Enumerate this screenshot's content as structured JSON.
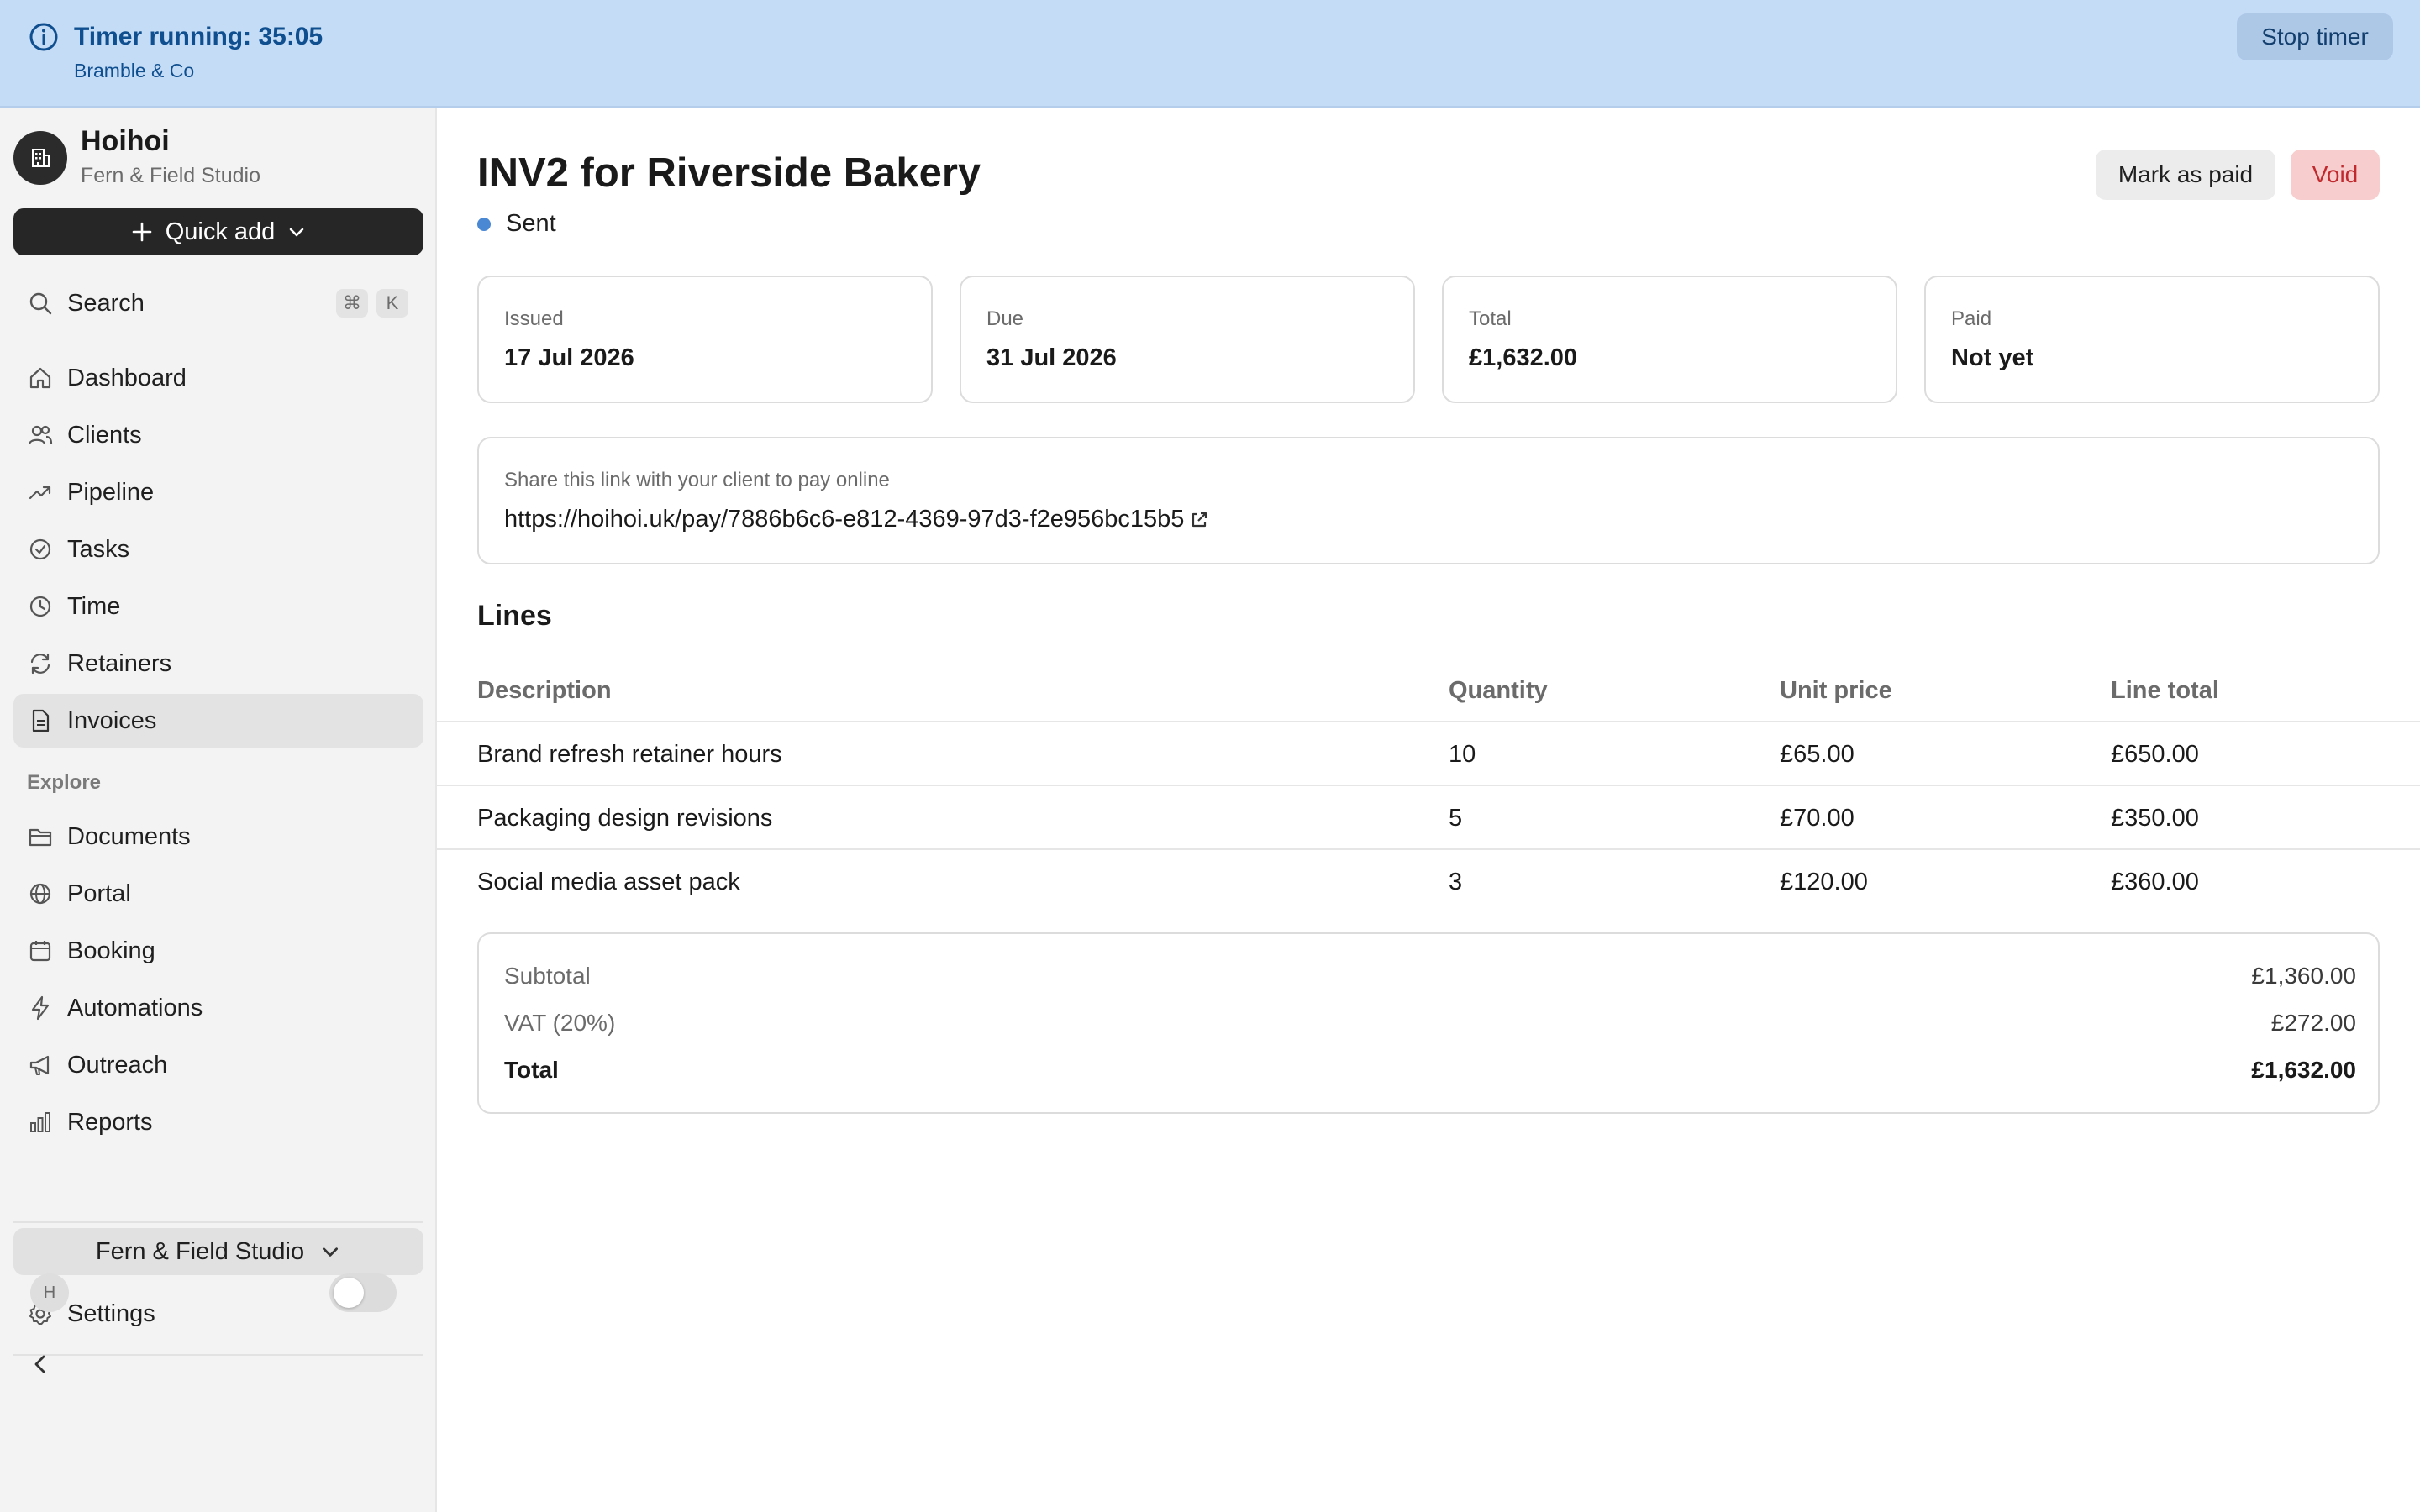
{
  "banner": {
    "timer_text": "Timer running: 35:05",
    "client": "Bramble & Co",
    "stop_label": "Stop timer",
    "background": "#c5dcf6"
  },
  "sidebar": {
    "app_name": "Hoihoi",
    "workspace_sub": "Fern & Field Studio",
    "quick_add_label": "Quick add",
    "search": {
      "label": "Search",
      "kbd_meta": "⌘",
      "kbd_key": "K"
    },
    "items": [
      {
        "label": "Dashboard",
        "icon": "home-icon"
      },
      {
        "label": "Clients",
        "icon": "users-icon"
      },
      {
        "label": "Pipeline",
        "icon": "trending-up-icon"
      },
      {
        "label": "Tasks",
        "icon": "check-circle-icon"
      },
      {
        "label": "Time",
        "icon": "clock-icon"
      },
      {
        "label": "Retainers",
        "icon": "refresh-icon"
      },
      {
        "label": "Invoices",
        "icon": "file-text-icon",
        "active": true
      }
    ],
    "explore_label": "Explore",
    "explore_items": [
      {
        "label": "Documents",
        "icon": "folder-icon"
      },
      {
        "label": "Portal",
        "icon": "globe-icon"
      },
      {
        "label": "Booking",
        "icon": "calendar-icon"
      },
      {
        "label": "Automations",
        "icon": "zap-icon"
      },
      {
        "label": "Outreach",
        "icon": "megaphone-icon"
      },
      {
        "label": "Reports",
        "icon": "bar-chart-icon"
      }
    ],
    "workspace_switcher": "Fern & Field Studio",
    "settings_label": "Settings",
    "avatar_initial": "H"
  },
  "invoice": {
    "title": "INV2 for Riverside Bakery",
    "status": "Sent",
    "status_color": "#4a88d4",
    "mark_paid_label": "Mark as paid",
    "void_label": "Void",
    "cards": [
      {
        "label": "Issued",
        "value": "17 Jul 2026"
      },
      {
        "label": "Due",
        "value": "31 Jul 2026"
      },
      {
        "label": "Total",
        "value": "£1,632.00"
      },
      {
        "label": "Paid",
        "value": "Not yet"
      }
    ],
    "share": {
      "label": "Share this link with your client to pay online",
      "url": "https://hoihoi.uk/pay/7886b6c6-e812-4369-97d3-f2e956bc15b5"
    },
    "lines_heading": "Lines",
    "columns": [
      "Description",
      "Quantity",
      "Unit price",
      "Line total"
    ],
    "lines": [
      {
        "description": "Brand refresh retainer hours",
        "quantity": "10",
        "unit_price": "£65.00",
        "line_total": "£650.00"
      },
      {
        "description": "Packaging design revisions",
        "quantity": "5",
        "unit_price": "£70.00",
        "line_total": "£350.00"
      },
      {
        "description": "Social media asset pack",
        "quantity": "3",
        "unit_price": "£120.00",
        "line_total": "£360.00"
      }
    ],
    "totals": {
      "subtotal_label": "Subtotal",
      "subtotal": "£1,360.00",
      "vat_label": "VAT (20%)",
      "vat": "£272.00",
      "total_label": "Total",
      "total": "£1,632.00"
    }
  }
}
